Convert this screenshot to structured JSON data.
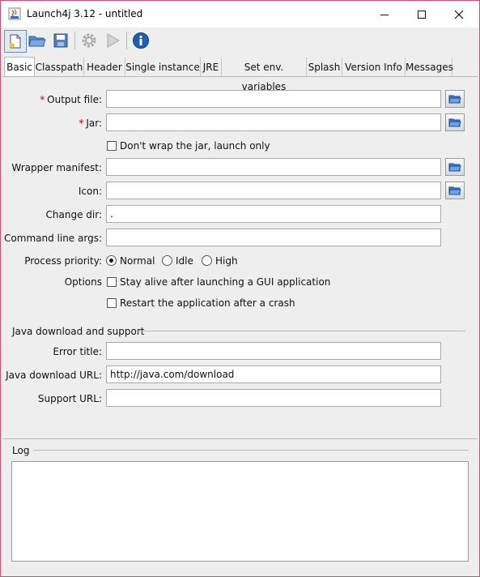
{
  "window": {
    "title": "Launch4j 3.12 - untitled",
    "icons": [
      "java-app-icon",
      "minimize-icon",
      "maximize-icon",
      "close-icon"
    ]
  },
  "toolbar": {
    "buttons": [
      "new-config-icon",
      "open-folder-icon",
      "save-icon",
      "build-gear-icon",
      "run-icon",
      "info-icon"
    ]
  },
  "tabs": [
    "Basic",
    "Classpath",
    "Header",
    "Single instance",
    "JRE",
    "Set env. variables",
    "Splash",
    "Version Info",
    "Messages"
  ],
  "active_tab": "Basic",
  "basic": {
    "output_file": {
      "label": "Output file:",
      "required_mark": "*",
      "value": ""
    },
    "jar": {
      "label": "Jar:",
      "required_mark": "*",
      "value": ""
    },
    "dont_wrap": {
      "label": "Don't wrap the jar, launch only",
      "checked": false
    },
    "wrapper_manifest": {
      "label": "Wrapper manifest:",
      "value": ""
    },
    "icon": {
      "label": "Icon:",
      "value": ""
    },
    "change_dir": {
      "label": "Change dir:",
      "value": "."
    },
    "cmd_args": {
      "label": "Command line args:",
      "value": ""
    },
    "priority": {
      "label": "Process priority:",
      "options": [
        "Normal",
        "Idle",
        "High"
      ],
      "selected": "Normal"
    },
    "options": {
      "label": "Options",
      "stay_alive": {
        "label": "Stay alive after launching a GUI application",
        "checked": false
      },
      "restart": {
        "label": "Restart the application after a crash",
        "checked": false
      }
    },
    "java_download": {
      "section_title": "Java download and support",
      "error_title": {
        "label": "Error title:",
        "value": ""
      },
      "download_url": {
        "label": "Java download URL:",
        "value": "http://java.com/download"
      },
      "support_url": {
        "label": "Support URL:",
        "value": ""
      }
    }
  },
  "log": {
    "title": "Log",
    "content": ""
  }
}
